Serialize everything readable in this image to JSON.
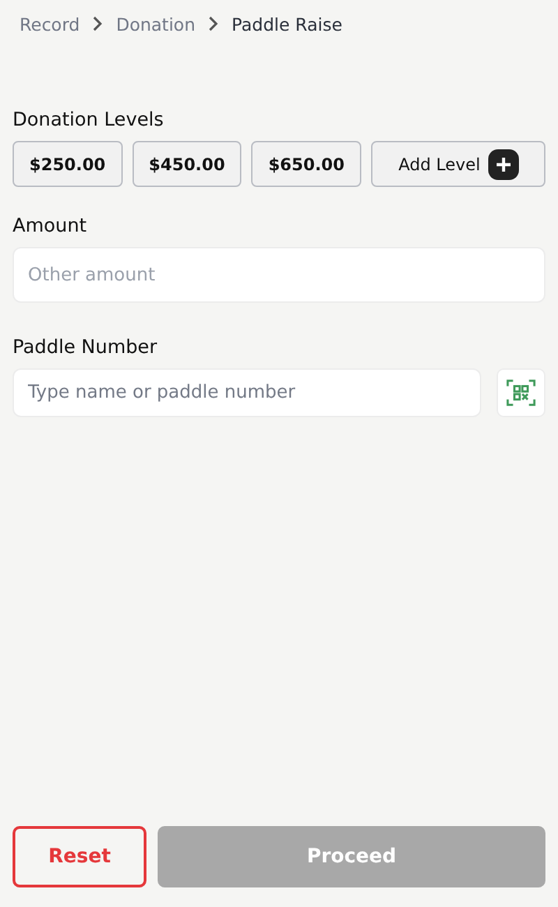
{
  "breadcrumb": [
    {
      "label": "Record",
      "current": false
    },
    {
      "label": "Donation",
      "current": false
    },
    {
      "label": "Paddle Raise",
      "current": true
    }
  ],
  "donation_levels": {
    "label": "Donation Levels",
    "levels": [
      "$250.00",
      "$450.00",
      "$650.00"
    ],
    "add_button": "Add Level"
  },
  "amount": {
    "label": "Amount",
    "placeholder": "Other amount"
  },
  "paddle_number": {
    "label": "Paddle Number",
    "placeholder": "Type name or paddle number"
  },
  "actions": [
    {
      "label": "Reset",
      "kind": "reset",
      "disabled": false
    },
    {
      "label": "Proceed",
      "kind": "proceed",
      "disabled": true
    }
  ]
}
